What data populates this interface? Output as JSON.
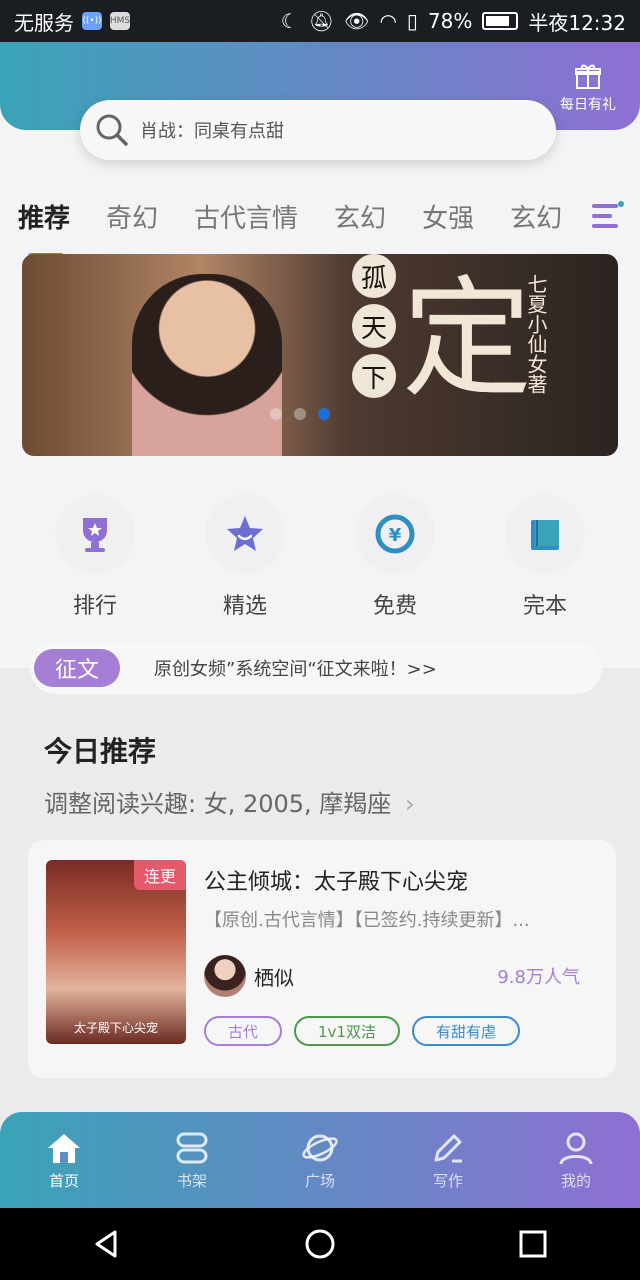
{
  "statusbar": {
    "carrier": "无服务",
    "hms": "HMS",
    "battery": "78%",
    "time": "半夜12:32"
  },
  "gift": {
    "label": "每日有礼"
  },
  "search": {
    "placeholder": "肖战：同桌有点甜"
  },
  "tabs": [
    "推荐",
    "奇幻",
    "古代言情",
    "玄幻",
    "女强",
    "玄幻"
  ],
  "banner": {
    "title_chars": [
      "孤",
      "天",
      "下"
    ],
    "big_char": "定",
    "author": "七夏小仙女著",
    "active_dot": 2,
    "dot_count": 3
  },
  "quick": [
    {
      "label": "排行",
      "icon": "trophy-icon"
    },
    {
      "label": "精选",
      "icon": "star-icon"
    },
    {
      "label": "免费",
      "icon": "free-coin-icon"
    },
    {
      "label": "完本",
      "icon": "book-icon"
    }
  ],
  "contest": {
    "tag": "征文",
    "text": "原创女频”系统空间“征文来啦！>>"
  },
  "today": {
    "heading": "今日推荐",
    "sub": "调整阅读兴趣: 女, 2005, 摩羯座"
  },
  "book": {
    "badge": "连更",
    "cover_title": "太子殿下心尖宠",
    "title": "公主倾城：太子殿下心尖宠",
    "desc": "【原创.古代言情】【已签约.持续更新】...",
    "author": "栖似",
    "popularity": "9.8万人气",
    "tags": [
      "古代",
      "1v1双洁",
      "有甜有虐"
    ]
  },
  "tabbar": [
    {
      "label": "首页",
      "icon": "home-icon",
      "active": true
    },
    {
      "label": "书架",
      "icon": "bookshelf-icon",
      "active": false
    },
    {
      "label": "广场",
      "icon": "planet-icon",
      "active": false
    },
    {
      "label": "写作",
      "icon": "pen-icon",
      "active": false
    },
    {
      "label": "我的",
      "icon": "profile-icon",
      "active": false
    }
  ],
  "colors": {
    "accent_purple": "#a57ed6",
    "teal": "#3aa3b7",
    "badge_red": "#e55a6a"
  }
}
